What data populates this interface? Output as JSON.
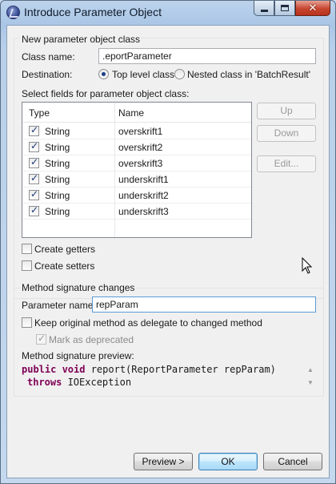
{
  "window": {
    "title": "Introduce Parameter Object"
  },
  "new_class": {
    "section_label": "New parameter object class",
    "class_name_label": "Class name:",
    "class_name_value": ".eportParameter",
    "destination_label": "Destination:",
    "top_level_label": "Top level class",
    "nested_label": "Nested class in 'BatchResult'",
    "fields_label": "Select fields for parameter object class:"
  },
  "table": {
    "columns": [
      "Type",
      "Name"
    ],
    "rows": [
      {
        "type": "String",
        "name": "overskrift1",
        "checked": true
      },
      {
        "type": "String",
        "name": "overskrift2",
        "checked": true
      },
      {
        "type": "String",
        "name": "overskrift3",
        "checked": true
      },
      {
        "type": "String",
        "name": "underskrift1",
        "checked": true
      },
      {
        "type": "String",
        "name": "underskrift2",
        "checked": true
      },
      {
        "type": "String",
        "name": "underskrift3",
        "checked": true
      }
    ]
  },
  "side_buttons": {
    "up": "Up",
    "down": "Down",
    "edit": "Edit..."
  },
  "getters_label": "Create getters",
  "setters_label": "Create setters",
  "method_sig": {
    "section_label": "Method signature changes",
    "param_name_label": "Parameter name:",
    "param_name_value": "repParam",
    "keep_original_label": "Keep original method as delegate to changed method",
    "mark_deprecated_label": "Mark as deprecated",
    "preview_label": "Method signature preview:",
    "code_line1_kw": "public void",
    "code_line1_rest": " report(ReportParameter repParam)",
    "code_line2_kw": "throws",
    "code_line2_rest": " IOException"
  },
  "buttons": {
    "preview": "Preview >",
    "ok": "OK",
    "cancel": "Cancel"
  },
  "colors": {
    "keyword": "#7f0055",
    "title_bar": "#aac6e6",
    "focus_border": "#5b9bd5"
  }
}
